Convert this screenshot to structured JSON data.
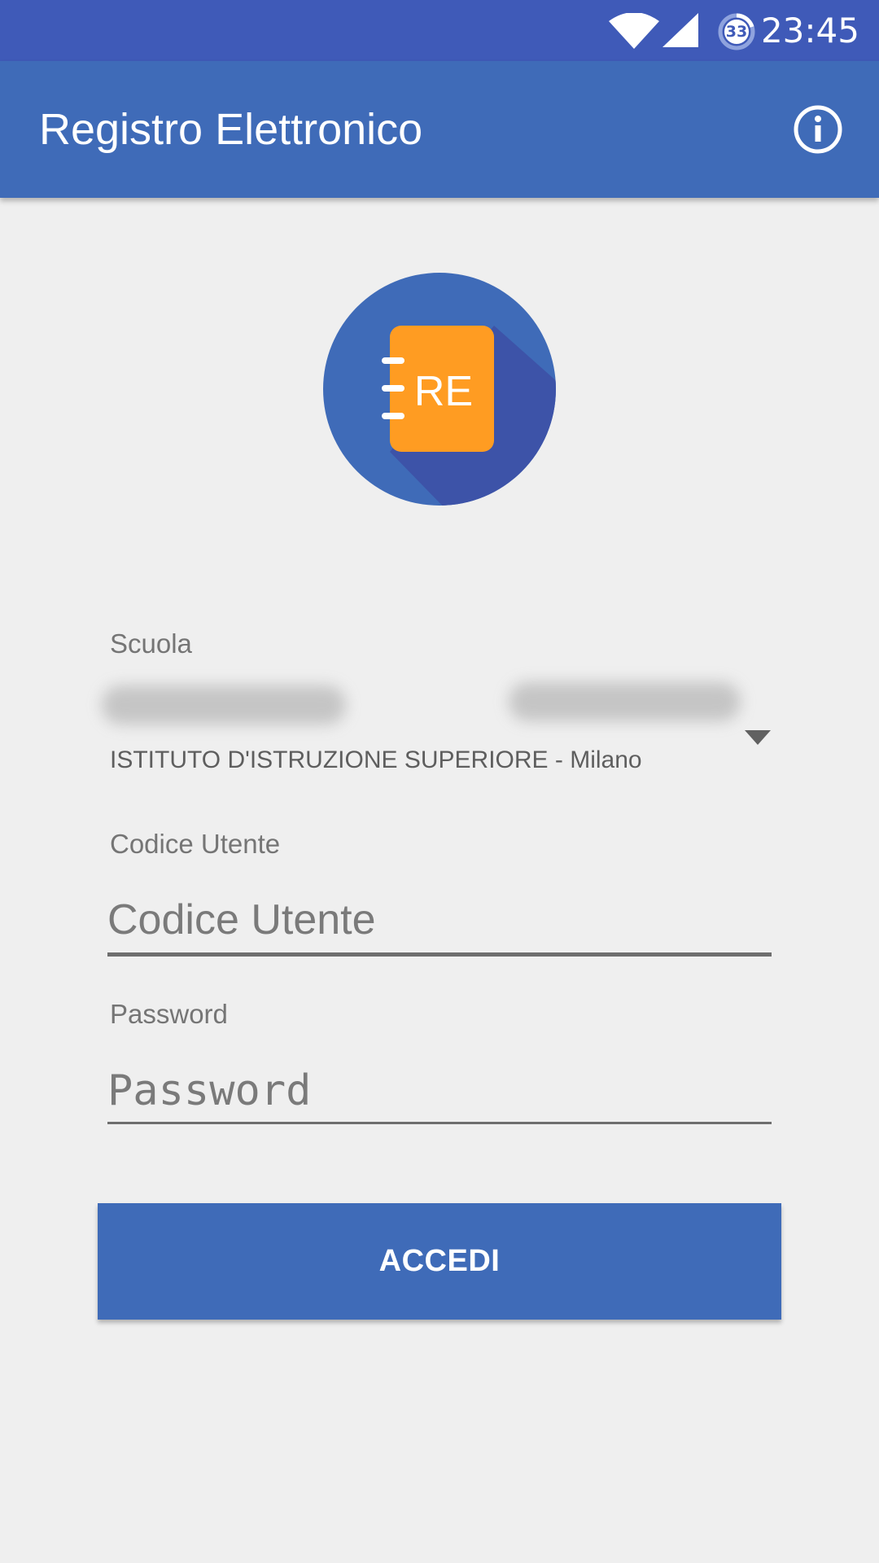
{
  "status_bar": {
    "battery_level": "33",
    "time": "23:45",
    "icons": [
      "wifi-icon",
      "cell-signal-icon",
      "battery-icon"
    ],
    "color": "#3F5AB8"
  },
  "app_bar": {
    "title": "Registro Elettronico",
    "info_icon": "info-icon",
    "color": "#3F6BB8"
  },
  "logo": {
    "text": "RE",
    "circle_color": "#3F6BB8",
    "book_color": "#FF9C22"
  },
  "form": {
    "school": {
      "label": "Scuola",
      "value_line2": "ISTITUTO D'ISTRUZIONE SUPERIORE - Milano"
    },
    "user_code": {
      "label": "Codice Utente",
      "placeholder": "Codice Utente",
      "value": ""
    },
    "password": {
      "label": "Password",
      "placeholder": "Password",
      "value": ""
    }
  },
  "login_button": {
    "label": "ACCEDI",
    "color": "#3F6BB8"
  }
}
